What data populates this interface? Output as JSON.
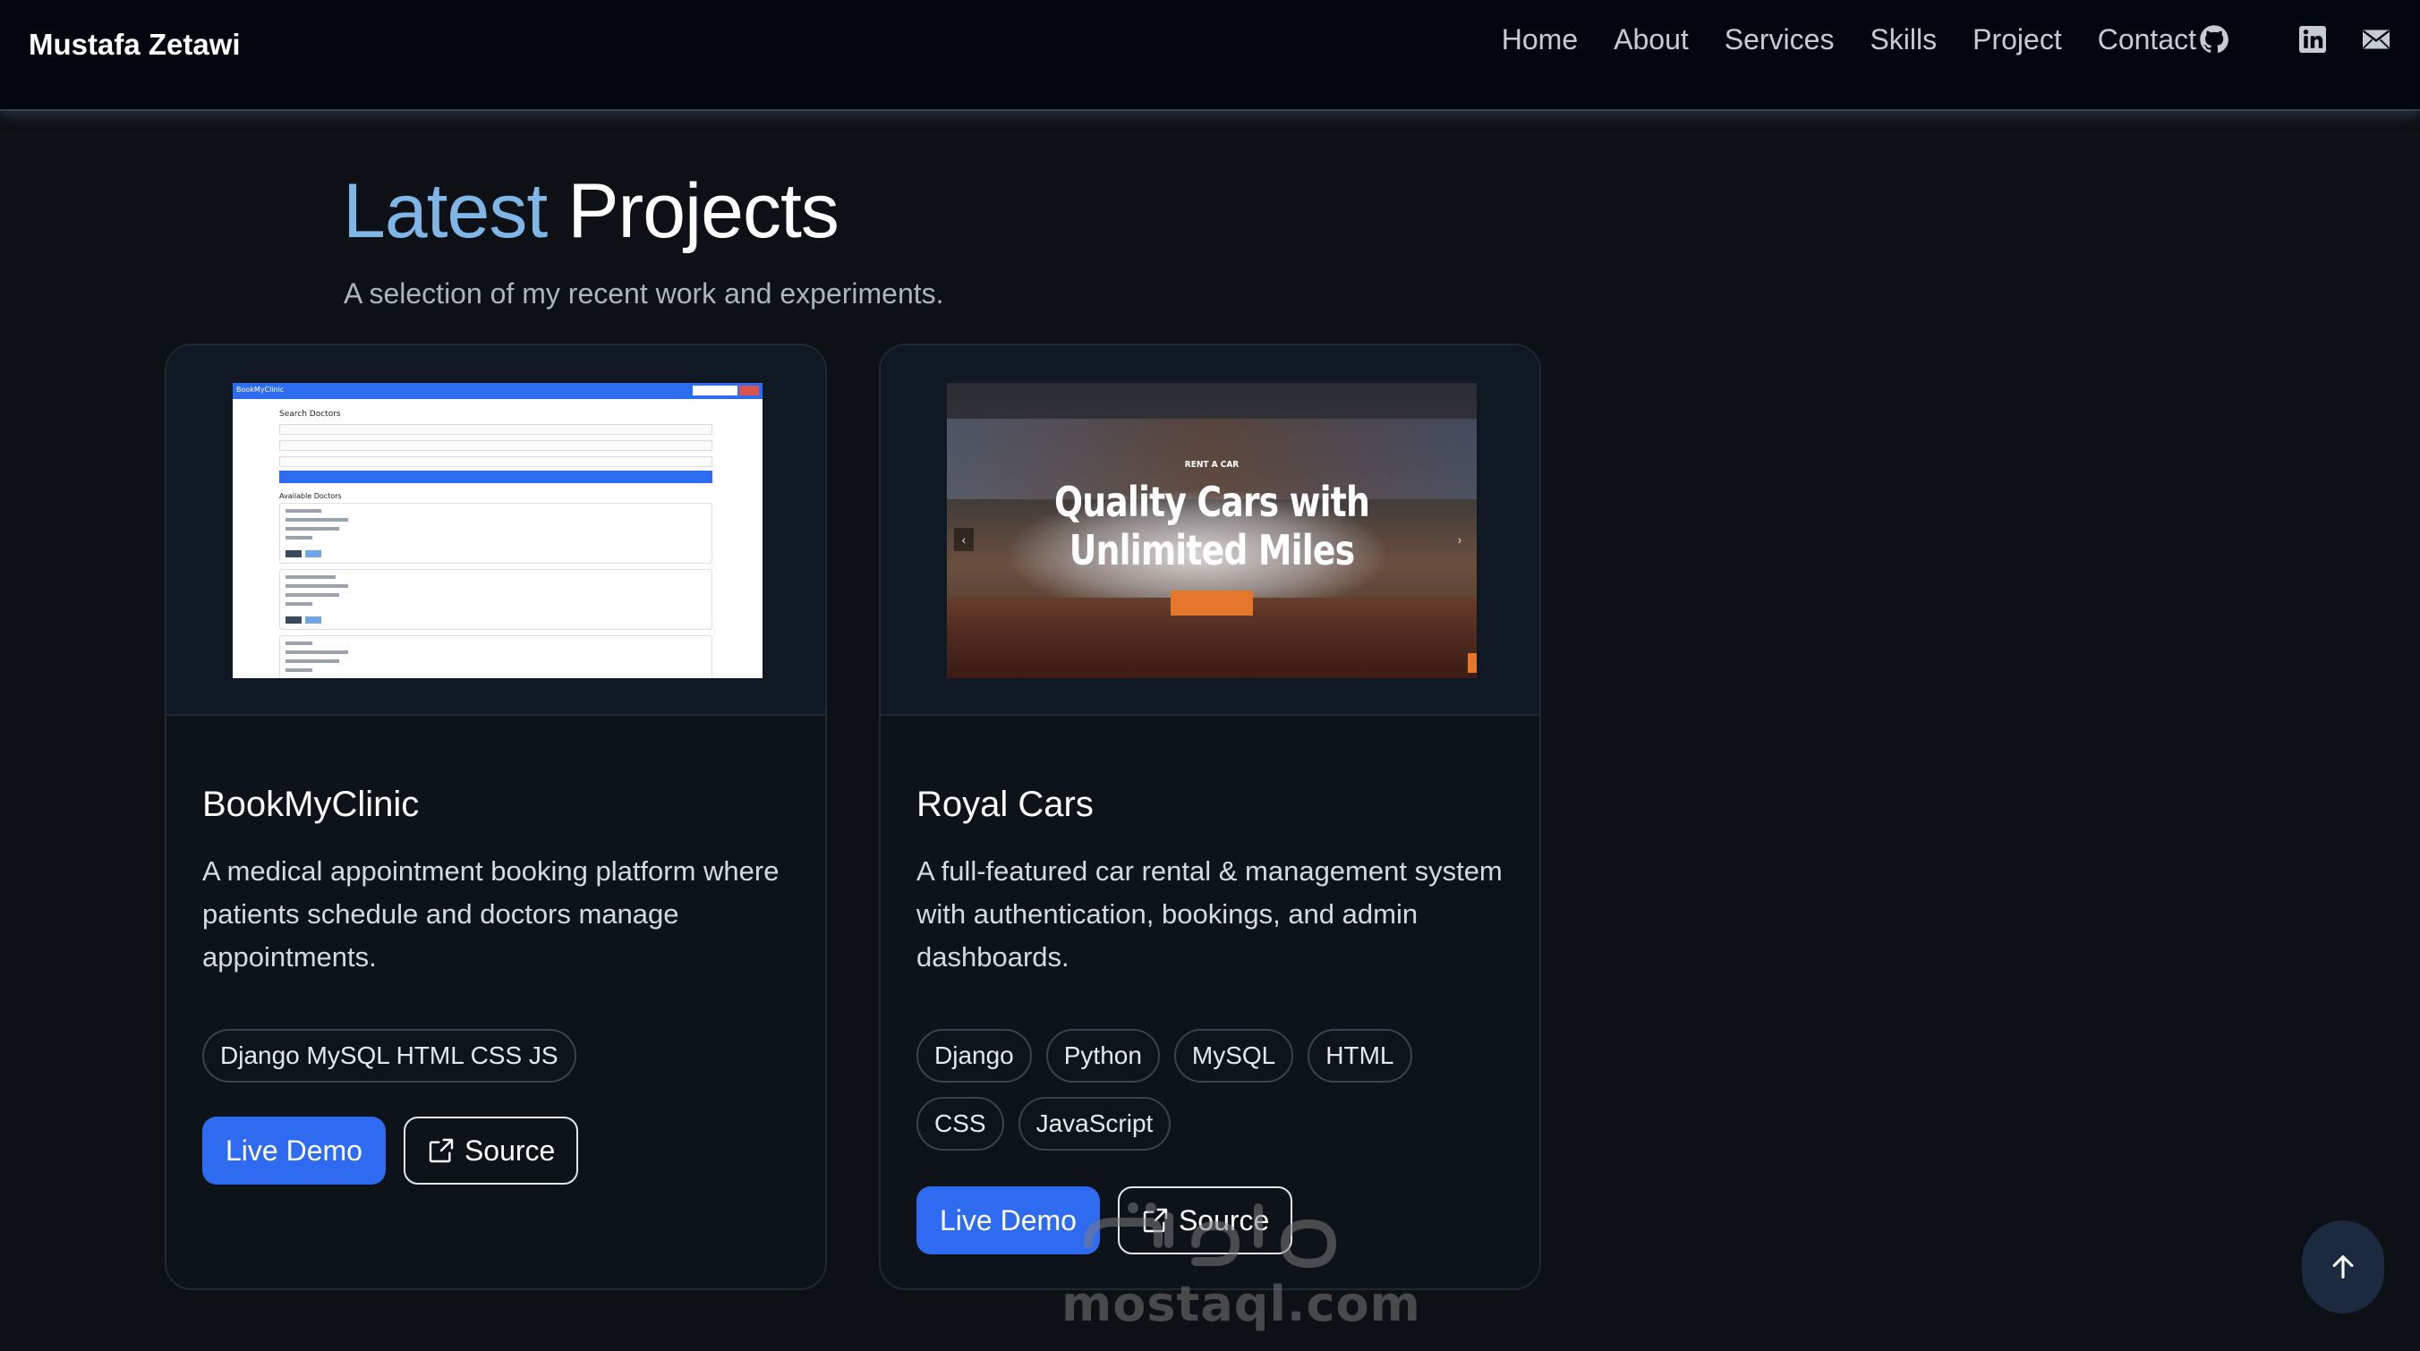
{
  "navbar": {
    "brand": "Mustafa Zetawi",
    "links": [
      "Home",
      "About",
      "Services",
      "Skills",
      "Project",
      "Contact"
    ],
    "icons": [
      "github-icon",
      "linkedin-icon",
      "mail-icon"
    ]
  },
  "section": {
    "title_accent": "Latest",
    "title_rest": "Projects",
    "subtitle": "A selection of my recent work and experiments."
  },
  "projects": [
    {
      "title": "BookMyClinic",
      "description": "A medical appointment booking platform where patients schedule and doctors manage appointments.",
      "tags": [
        "Django MySQL HTML CSS JS"
      ],
      "demo_label": "Live Demo",
      "source_label": "Source",
      "thumbnail": {
        "brand": "BookMyClinic",
        "heading": "Search Doctors",
        "subheading": "Available Doctors"
      }
    },
    {
      "title": "Royal Cars",
      "description": "A full-featured car rental & management system with authentication, bookings, and admin dashboards.",
      "tags": [
        "Django",
        "Python",
        "MySQL",
        "HTML",
        "CSS",
        "JavaScript"
      ],
      "demo_label": "Live Demo",
      "source_label": "Source",
      "thumbnail": {
        "small_caption": "RENT A CAR",
        "headline_line1": "Quality Cars with",
        "headline_line2": "Unlimited Miles"
      }
    }
  ],
  "watermark": {
    "text": "mostaql.com"
  },
  "colors": {
    "accent": "#7fb6e8",
    "primary_button": "#2f6bf0",
    "background": "#0d1014",
    "nav_background": "#03050f"
  }
}
